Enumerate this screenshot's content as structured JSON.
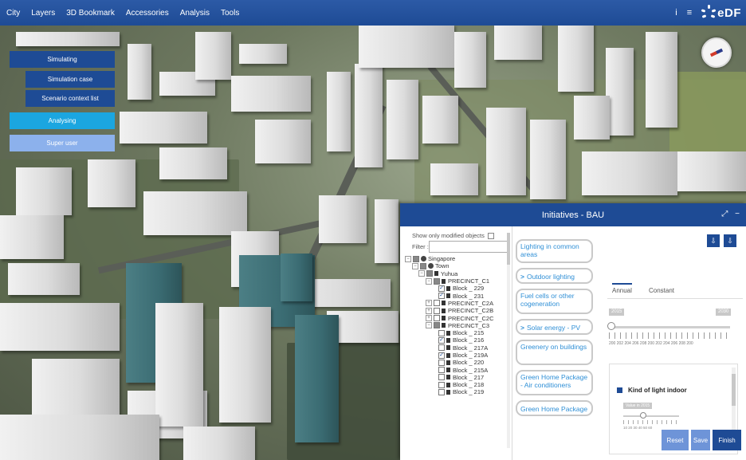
{
  "topbar": {
    "menu": [
      "City",
      "Layers",
      "3D Bookmark",
      "Accessories",
      "Analysis",
      "Tools"
    ],
    "icons": [
      "info-icon",
      "menu-icon"
    ],
    "info_glyph": "i",
    "menu_glyph": "≡",
    "logo_text": "eDF"
  },
  "left_menu": {
    "simulating": "Simulating",
    "simulation_case": "Simulation case",
    "scenario_context_list": "Scenario context list",
    "analysing": "Analysing",
    "super_user": "Super user"
  },
  "panel": {
    "title": "Initiatives - BAU",
    "expand_glyph": "⤢",
    "minimize_glyph": "−",
    "show_only_label": "Show only modified objects",
    "filter_label": "Filter :",
    "tree": [
      {
        "label": "Singapore"
      },
      {
        "label": "Town"
      },
      {
        "label": "Yuhua"
      },
      {
        "label": "PRECINCT_C1"
      },
      {
        "label": "Block _ 229"
      },
      {
        "label": "Block _ 231"
      },
      {
        "label": "PRECINCT_C2A"
      },
      {
        "label": "PRECINCT_C2B"
      },
      {
        "label": "PRECINCT_C2C"
      },
      {
        "label": "PRECINCT_C3"
      },
      {
        "label": "Block _ 215"
      },
      {
        "label": "Block _ 216"
      },
      {
        "label": "Block _ 217A"
      },
      {
        "label": "Block _ 219A"
      },
      {
        "label": "Block _ 220"
      },
      {
        "label": "Block _ 215A"
      },
      {
        "label": "Block _ 217"
      },
      {
        "label": "Block _ 218"
      },
      {
        "label": "Block _ 219"
      }
    ],
    "initiatives": [
      {
        "label": "Lighting in common areas"
      },
      {
        "label": "Outdoor lighting"
      },
      {
        "label": "Fuel cells or other cogeneration"
      },
      {
        "label": "Solar energy - PV"
      },
      {
        "label": "Greenery on buildings"
      },
      {
        "label": "Green Home Package - Air conditioners"
      },
      {
        "label": "Green Home Package"
      }
    ],
    "tabs": {
      "annual": "Annual",
      "constant": "Constant"
    },
    "range_min": "2015",
    "range_max": "2030",
    "tick_labels": "200 202 204 206 208 200 202 204 206 208 200",
    "light_label": "Kind of light indoor",
    "mini_value": "Value in 2015",
    "mini_ticks": "10 20 30 40 50 60",
    "buttons": {
      "reset": "Reset",
      "save": "Save",
      "finish": "Finish"
    },
    "download_glyph": "⇩"
  }
}
